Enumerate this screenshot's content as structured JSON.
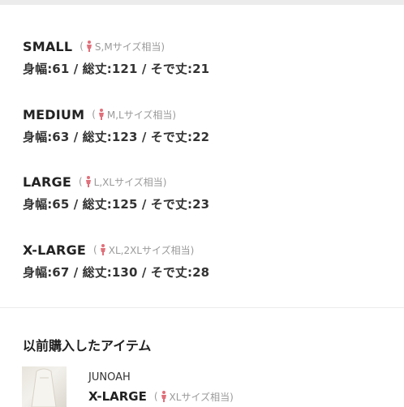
{
  "sizes": [
    {
      "name": "SMALL",
      "note_open": "(",
      "note": "S,Mサイズ相当)",
      "dims": "身幅:61 / 総丈:121 / そで丈:21"
    },
    {
      "name": "MEDIUM",
      "note_open": "(",
      "note": "M,Lサイズ相当)",
      "dims": "身幅:63 / 総丈:123 / そで丈:22"
    },
    {
      "name": "LARGE",
      "note_open": "(",
      "note": "L,XLサイズ相当)",
      "dims": "身幅:65 / 総丈:125 / そで丈:23"
    },
    {
      "name": "X-LARGE",
      "note_open": "(",
      "note": "XL,2XLサイズ相当)",
      "dims": "身幅:67 / 総丈:130 / そで丈:28"
    }
  ],
  "purchase": {
    "title": "以前購入したアイテム",
    "brand": "JUNOAH",
    "size": "X-LARGE",
    "note_open": "(",
    "note": "XLサイズ相当)"
  },
  "icons": {
    "person": "person-icon",
    "accent": "#e0707a"
  }
}
